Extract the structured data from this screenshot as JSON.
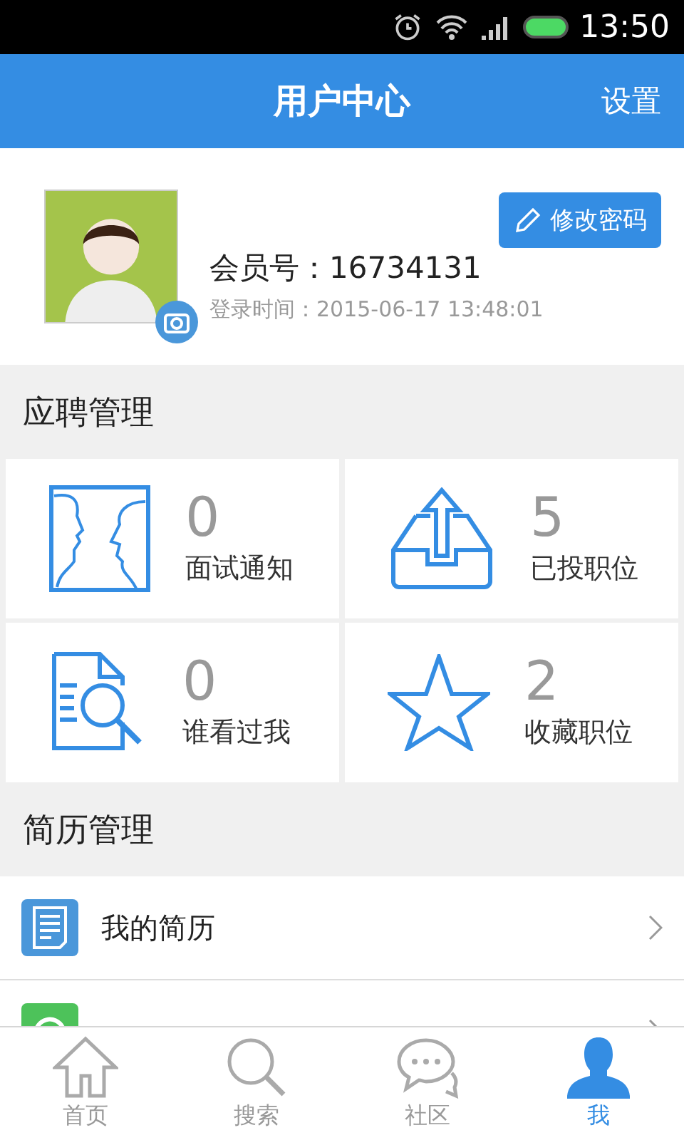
{
  "status_bar": {
    "time": "13:50"
  },
  "header": {
    "title": "用户中心",
    "action": "设置"
  },
  "profile": {
    "change_password": "修改密码",
    "member_label": "会员号：16734131",
    "login_time": "登录时间：2015-06-17 13:48:01"
  },
  "job_section": {
    "title": "应聘管理",
    "tiles": [
      {
        "kind": "interview",
        "count": "0",
        "label": "面试通知"
      },
      {
        "kind": "applied",
        "count": "5",
        "label": "已投职位"
      },
      {
        "kind": "viewed",
        "count": "0",
        "label": "谁看过我"
      },
      {
        "kind": "favorites",
        "count": "2",
        "label": "收藏职位"
      }
    ]
  },
  "resume_section": {
    "title": "简历管理",
    "rows": [
      {
        "kind": "resume",
        "label": "我的简历"
      },
      {
        "kind": "refresh"
      }
    ]
  },
  "tab_bar": [
    {
      "kind": "home",
      "label": "首页",
      "selected": false
    },
    {
      "kind": "search",
      "label": "搜索",
      "selected": false
    },
    {
      "kind": "chat",
      "label": "社区",
      "selected": false
    },
    {
      "kind": "me",
      "label": "我",
      "selected": true
    }
  ]
}
